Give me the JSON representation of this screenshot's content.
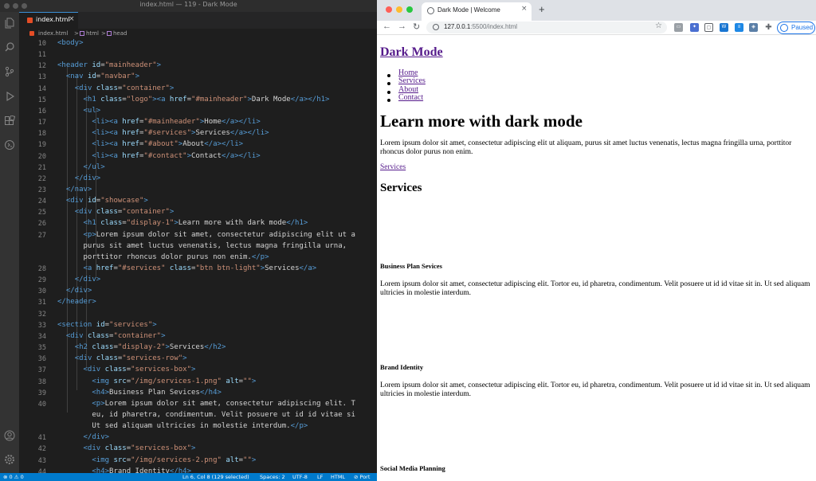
{
  "editor": {
    "window_title": "index.html — 119 - Dark Mode",
    "tab": {
      "label": "index.html",
      "close": "×"
    },
    "breadcrumbs": [
      "index.html",
      ">",
      "html",
      ">",
      "head"
    ],
    "code_lines": [
      {
        "n": "10",
        "tokens": [
          [
            "t",
            "<body>"
          ]
        ]
      },
      {
        "n": "11",
        "tokens": []
      },
      {
        "n": "12",
        "tokens": [
          [
            "t",
            "<header "
          ],
          [
            "a",
            "id"
          ],
          [
            "x",
            "="
          ],
          [
            "s",
            "\"mainheader\""
          ],
          [
            "t",
            ">"
          ]
        ]
      },
      {
        "n": "13",
        "tokens": [
          [
            "x",
            "  "
          ],
          [
            "t",
            "<nav "
          ],
          [
            "a",
            "id"
          ],
          [
            "x",
            "="
          ],
          [
            "s",
            "\"navbar\""
          ],
          [
            "t",
            ">"
          ]
        ]
      },
      {
        "n": "14",
        "tokens": [
          [
            "x",
            "    "
          ],
          [
            "t",
            "<div "
          ],
          [
            "a",
            "class"
          ],
          [
            "x",
            "="
          ],
          [
            "s",
            "\"container\""
          ],
          [
            "t",
            ">"
          ]
        ]
      },
      {
        "n": "15",
        "tokens": [
          [
            "x",
            "      "
          ],
          [
            "t",
            "<h1 "
          ],
          [
            "a",
            "class"
          ],
          [
            "x",
            "="
          ],
          [
            "s",
            "\"logo\""
          ],
          [
            "t",
            "><a "
          ],
          [
            "a",
            "href"
          ],
          [
            "x",
            "="
          ],
          [
            "s",
            "\"#mainheader\""
          ],
          [
            "t",
            ">"
          ],
          [
            "x",
            "Dark Mode"
          ],
          [
            "t",
            "</a></h1>"
          ]
        ]
      },
      {
        "n": "16",
        "tokens": [
          [
            "x",
            "      "
          ],
          [
            "t",
            "<ul>"
          ]
        ]
      },
      {
        "n": "17",
        "tokens": [
          [
            "x",
            "        "
          ],
          [
            "t",
            "<li><a "
          ],
          [
            "a",
            "href"
          ],
          [
            "x",
            "="
          ],
          [
            "s",
            "\"#mainheader\""
          ],
          [
            "t",
            ">"
          ],
          [
            "x",
            "Home"
          ],
          [
            "t",
            "</a></li>"
          ]
        ]
      },
      {
        "n": "18",
        "tokens": [
          [
            "x",
            "        "
          ],
          [
            "t",
            "<li><a "
          ],
          [
            "a",
            "href"
          ],
          [
            "x",
            "="
          ],
          [
            "s",
            "\"#services\""
          ],
          [
            "t",
            ">"
          ],
          [
            "x",
            "Services"
          ],
          [
            "t",
            "</a></li>"
          ]
        ]
      },
      {
        "n": "19",
        "tokens": [
          [
            "x",
            "        "
          ],
          [
            "t",
            "<li><a "
          ],
          [
            "a",
            "href"
          ],
          [
            "x",
            "="
          ],
          [
            "s",
            "\"#about\""
          ],
          [
            "t",
            ">"
          ],
          [
            "x",
            "About"
          ],
          [
            "t",
            "</a></li>"
          ]
        ]
      },
      {
        "n": "20",
        "tokens": [
          [
            "x",
            "        "
          ],
          [
            "t",
            "<li><a "
          ],
          [
            "a",
            "href"
          ],
          [
            "x",
            "="
          ],
          [
            "s",
            "\"#contact\""
          ],
          [
            "t",
            ">"
          ],
          [
            "x",
            "Contact"
          ],
          [
            "t",
            "</a></li>"
          ]
        ]
      },
      {
        "n": "21",
        "tokens": [
          [
            "x",
            "      "
          ],
          [
            "t",
            "</ul>"
          ]
        ]
      },
      {
        "n": "22",
        "tokens": [
          [
            "x",
            "    "
          ],
          [
            "t",
            "</div>"
          ]
        ]
      },
      {
        "n": "23",
        "tokens": [
          [
            "x",
            "  "
          ],
          [
            "t",
            "</nav>"
          ]
        ]
      },
      {
        "n": "24",
        "tokens": [
          [
            "x",
            "  "
          ],
          [
            "t",
            "<div "
          ],
          [
            "a",
            "id"
          ],
          [
            "x",
            "="
          ],
          [
            "s",
            "\"showcase\""
          ],
          [
            "t",
            ">"
          ]
        ]
      },
      {
        "n": "25",
        "tokens": [
          [
            "x",
            "    "
          ],
          [
            "t",
            "<div "
          ],
          [
            "a",
            "class"
          ],
          [
            "x",
            "="
          ],
          [
            "s",
            "\"container\""
          ],
          [
            "t",
            ">"
          ]
        ]
      },
      {
        "n": "26",
        "tokens": [
          [
            "x",
            "      "
          ],
          [
            "t",
            "<h1 "
          ],
          [
            "a",
            "class"
          ],
          [
            "x",
            "="
          ],
          [
            "s",
            "\"display-1\""
          ],
          [
            "t",
            ">"
          ],
          [
            "x",
            "Learn more with dark mode"
          ],
          [
            "t",
            "</h1>"
          ]
        ]
      },
      {
        "n": "27",
        "tokens": [
          [
            "x",
            "      "
          ],
          [
            "t",
            "<p>"
          ],
          [
            "x",
            "Lorem ipsum dolor sit amet, consectetur adipiscing elit ut a"
          ]
        ]
      },
      {
        "n": "",
        "tokens": [
          [
            "x",
            "      purus sit amet luctus venenatis, lectus magna fringilla urna,"
          ]
        ]
      },
      {
        "n": "",
        "tokens": [
          [
            "x",
            "      porttitor rhoncus dolor purus non enim."
          ],
          [
            "t",
            "</p>"
          ]
        ]
      },
      {
        "n": "28",
        "tokens": [
          [
            "x",
            "      "
          ],
          [
            "t",
            "<a "
          ],
          [
            "a",
            "href"
          ],
          [
            "x",
            "="
          ],
          [
            "s",
            "\"#services\""
          ],
          [
            "x",
            " "
          ],
          [
            "a",
            "class"
          ],
          [
            "x",
            "="
          ],
          [
            "s",
            "\"btn btn-light\""
          ],
          [
            "t",
            ">"
          ],
          [
            "x",
            "Services"
          ],
          [
            "t",
            "</a>"
          ]
        ]
      },
      {
        "n": "29",
        "tokens": [
          [
            "x",
            "    "
          ],
          [
            "t",
            "</div>"
          ]
        ]
      },
      {
        "n": "30",
        "tokens": [
          [
            "x",
            "  "
          ],
          [
            "t",
            "</div>"
          ]
        ]
      },
      {
        "n": "31",
        "tokens": [
          [
            "t",
            "</header>"
          ]
        ]
      },
      {
        "n": "32",
        "tokens": []
      },
      {
        "n": "33",
        "tokens": [
          [
            "t",
            "<section "
          ],
          [
            "a",
            "id"
          ],
          [
            "x",
            "="
          ],
          [
            "s",
            "\"services\""
          ],
          [
            "t",
            ">"
          ]
        ]
      },
      {
        "n": "34",
        "tokens": [
          [
            "x",
            "  "
          ],
          [
            "t",
            "<div "
          ],
          [
            "a",
            "class"
          ],
          [
            "x",
            "="
          ],
          [
            "s",
            "\"container\""
          ],
          [
            "t",
            ">"
          ]
        ]
      },
      {
        "n": "35",
        "tokens": [
          [
            "x",
            "    "
          ],
          [
            "t",
            "<h2 "
          ],
          [
            "a",
            "class"
          ],
          [
            "x",
            "="
          ],
          [
            "s",
            "\"display-2\""
          ],
          [
            "t",
            ">"
          ],
          [
            "x",
            "Services"
          ],
          [
            "t",
            "</h2>"
          ]
        ]
      },
      {
        "n": "36",
        "tokens": [
          [
            "x",
            "    "
          ],
          [
            "t",
            "<div "
          ],
          [
            "a",
            "class"
          ],
          [
            "x",
            "="
          ],
          [
            "s",
            "\"services-row\""
          ],
          [
            "t",
            ">"
          ]
        ]
      },
      {
        "n": "37",
        "tokens": [
          [
            "x",
            "      "
          ],
          [
            "t",
            "<div "
          ],
          [
            "a",
            "class"
          ],
          [
            "x",
            "="
          ],
          [
            "s",
            "\"services-box\""
          ],
          [
            "t",
            ">"
          ]
        ]
      },
      {
        "n": "38",
        "tokens": [
          [
            "x",
            "        "
          ],
          [
            "t",
            "<img "
          ],
          [
            "a",
            "src"
          ],
          [
            "x",
            "="
          ],
          [
            "s",
            "\"/img/services-1.png\""
          ],
          [
            "x",
            " "
          ],
          [
            "a",
            "alt"
          ],
          [
            "x",
            "="
          ],
          [
            "s",
            "\"\""
          ],
          [
            "t",
            ">"
          ]
        ]
      },
      {
        "n": "39",
        "tokens": [
          [
            "x",
            "        "
          ],
          [
            "t",
            "<h4>"
          ],
          [
            "x",
            "Business Plan Sevices"
          ],
          [
            "t",
            "</h4>"
          ]
        ]
      },
      {
        "n": "40",
        "tokens": [
          [
            "x",
            "        "
          ],
          [
            "t",
            "<p>"
          ],
          [
            "x",
            "Lorem ipsum dolor sit amet, consectetur adipiscing elit. T"
          ]
        ]
      },
      {
        "n": "",
        "tokens": [
          [
            "x",
            "        eu, id pharetra, condimentum. Velit posuere ut id id vitae si"
          ]
        ]
      },
      {
        "n": "",
        "tokens": [
          [
            "x",
            "        Ut sed aliquam ultricies in molestie interdum."
          ],
          [
            "t",
            "</p>"
          ]
        ]
      },
      {
        "n": "41",
        "tokens": [
          [
            "x",
            "      "
          ],
          [
            "t",
            "</div>"
          ]
        ]
      },
      {
        "n": "42",
        "tokens": [
          [
            "x",
            "      "
          ],
          [
            "t",
            "<div "
          ],
          [
            "a",
            "class"
          ],
          [
            "x",
            "="
          ],
          [
            "s",
            "\"services-box\""
          ],
          [
            "t",
            ">"
          ]
        ]
      },
      {
        "n": "43",
        "tokens": [
          [
            "x",
            "        "
          ],
          [
            "t",
            "<img "
          ],
          [
            "a",
            "src"
          ],
          [
            "x",
            "="
          ],
          [
            "s",
            "\"/img/services-2.png\""
          ],
          [
            "x",
            " "
          ],
          [
            "a",
            "alt"
          ],
          [
            "x",
            "="
          ],
          [
            "s",
            "\"\""
          ],
          [
            "t",
            ">"
          ]
        ]
      },
      {
        "n": "44",
        "tokens": [
          [
            "x",
            "        "
          ],
          [
            "t",
            "<h4>"
          ],
          [
            "x",
            "Brand Identity"
          ],
          [
            "t",
            "</h4>"
          ]
        ]
      }
    ],
    "status": {
      "problems": "⊗ 0 ⚠ 0",
      "cursor": "Ln 6, Col 8 (129 selected)",
      "spaces": "Spaces: 2",
      "encoding": "UTF-8",
      "eol": "LF",
      "language": "HTML",
      "port": "⊘ Port"
    }
  },
  "browser": {
    "tab_title": "Dark Mode | Welcome",
    "tab_close": "×",
    "new_tab": "+",
    "url_host": "127.0.0.1",
    "url_rest": ":5500/index.html",
    "profile_label": "Paused",
    "colors": {
      "link_visited": "#551a8b",
      "profile_blue": "#1a73e8"
    }
  },
  "page": {
    "logo": "Dark Mode",
    "nav": [
      "Home",
      "Services",
      "About",
      "Contact"
    ],
    "display1": "Learn more with dark mode",
    "showcase_text": "Lorem ipsum dolor sit amet, consectetur adipiscing elit ut aliquam, purus sit amet luctus venenatis, lectus magna fringilla urna, porttitor rhoncus dolor purus non enim.",
    "showcase_button": "Services",
    "display2": "Services",
    "services": [
      {
        "title": "Business Plan Sevices",
        "text": "Lorem ipsum dolor sit amet, consectetur adipiscing elit. Tortor eu, id pharetra, condimentum. Velit posuere ut id id vitae sit in. Ut sed aliquam ultricies in molestie interdum."
      },
      {
        "title": "Brand Identity",
        "text": "Lorem ipsum dolor sit amet, consectetur adipiscing elit. Tortor eu, id pharetra, condimentum. Velit posuere ut id id vitae sit in. Ut sed aliquam ultricies in molestie interdum."
      },
      {
        "title": "Social Media Planning"
      }
    ]
  }
}
